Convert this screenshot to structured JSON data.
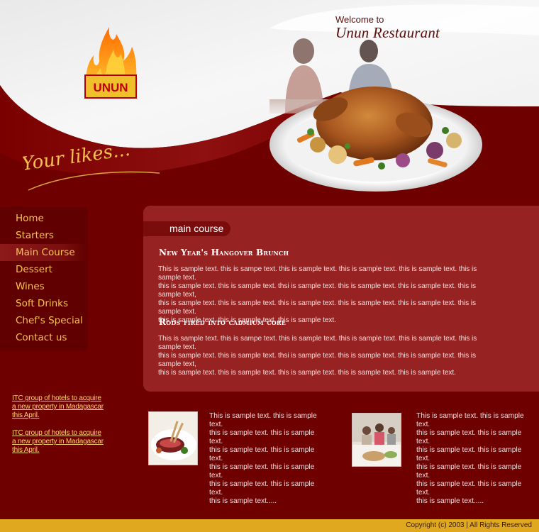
{
  "header": {
    "welcome_small": "Welcome to",
    "welcome_name": "Unun Restaurant",
    "logo_text": "UNUN",
    "tagline": "Your likes..."
  },
  "nav": {
    "items": [
      {
        "label": "Home"
      },
      {
        "label": "Starters"
      },
      {
        "label": "Main Course",
        "active": true
      },
      {
        "label": "Dessert"
      },
      {
        "label": "Wines"
      },
      {
        "label": "Soft Drinks"
      },
      {
        "label": "Chef's Special"
      },
      {
        "label": "Contact us"
      }
    ]
  },
  "main": {
    "section_label": "main course",
    "articles": [
      {
        "title": "New Year's Hangover Brunch",
        "lines": [
          "This is sample text. this is sampe text. this is sample text. this is sample text. this is sample text. this is sample text.",
          "this is sample text. this is sample text. thsi is sample text. this is sample text. this is sample text. this is sample text,",
          "this is sample text. this is sample text. this is sample text. this is sample text. this is sample text. this is sample text.",
          "this is sample text. this is sample text. this is sample text."
        ]
      },
      {
        "title": "Rods fired into cadmium core",
        "lines": [
          "This is sample text. this is sampe text. this is sample text. this is sample text. this is sample text. this is sample text.",
          "this is sample text. this is sample text. thsi is sample text. this is sample text. this is sample text. this is sample text,",
          "this is sample text. this is sample text. this is sample text. this is sample text. this is sample text."
        ]
      }
    ]
  },
  "news": {
    "items": [
      {
        "lines": [
          "ITC group of hotels to acquire",
          "a new property in Madagascar",
          "this April."
        ]
      },
      {
        "lines": [
          "ITC group of hotels to acquire",
          "a new property in Madagascar",
          "this April."
        ]
      }
    ]
  },
  "featured": {
    "items": [
      {
        "image": "plated-steak-dish",
        "lines": [
          "This is sample text. this is sample text.",
          "this is sample text. this is sample text.",
          "this is sample text. this is sample text.",
          "this is sample text. this is sample text.",
          "this is sample text. this is sample text.",
          "this is sample text....."
        ]
      },
      {
        "image": "family-dining-photo",
        "lines": [
          "This is sample text. this is sample text.",
          "this is sample text. this is sample text.",
          "this is sample text. this is sample text.",
          "this is sample text. this is sample text.",
          "this is sample text. this is sample text.",
          "this is sample text....."
        ]
      }
    ]
  },
  "footer": {
    "copyright": "Copyright (c) 2003  |   All Rights Reserved"
  },
  "colors": {
    "background": "#6e0000",
    "panel": "#962322",
    "nav_text": "#f5c54d",
    "footer_bar": "#e0a81f"
  }
}
